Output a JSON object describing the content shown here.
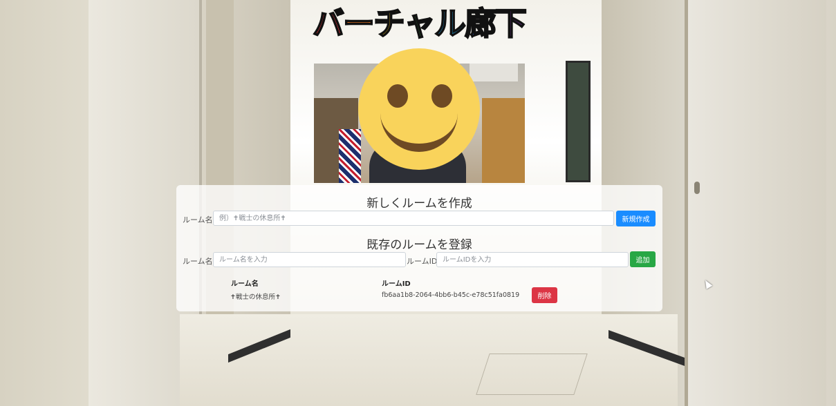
{
  "app": {
    "title_chars": [
      {
        "text": "バ",
        "color": "#e8333a"
      },
      {
        "text": "ー",
        "color": "#f0761f"
      },
      {
        "text": "チ",
        "color": "#f1c21b"
      },
      {
        "text": "ャ",
        "color": "#3cb443"
      },
      {
        "text": "ル",
        "color": "#26a6e0"
      },
      {
        "text": "廊",
        "color": "#2f5fcf"
      },
      {
        "text": "下",
        "color": "#9b3fd0"
      }
    ]
  },
  "create_room": {
    "heading": "新しくルームを作成",
    "name_label": "ルーム名",
    "name_placeholder": "例）✝戦士の休息所✝",
    "button_label": "新規作成",
    "button_color": "#1a8cff"
  },
  "register_room": {
    "heading": "既存のルームを登録",
    "name_label": "ルーム名",
    "name_placeholder": "ルーム名を入力",
    "id_label": "ルームID",
    "id_placeholder": "ルームIDを入力",
    "button_label": "追加",
    "button_color": "#28a745"
  },
  "rooms_table": {
    "columns": [
      "ルーム名",
      "ルームID"
    ],
    "rows": [
      {
        "name": "✝戦士の休息所✝",
        "id": "fb6aa1b8-2064-4bb6-b45c-e78c51fa0819",
        "delete_label": "削除"
      }
    ],
    "delete_color": "#dc3545"
  }
}
